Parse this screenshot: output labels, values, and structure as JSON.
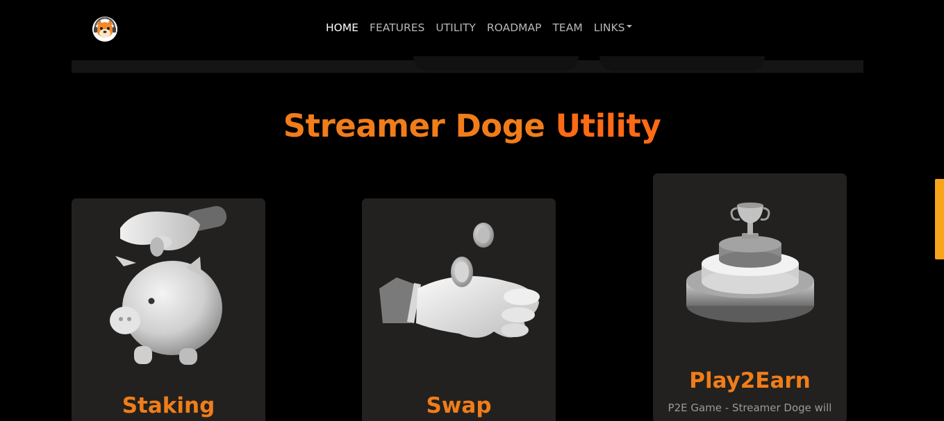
{
  "nav": {
    "logo_alt": "Streamer Doge logo",
    "links": [
      {
        "label": "HOME",
        "active": true
      },
      {
        "label": "FEATURES"
      },
      {
        "label": "UTILITY"
      },
      {
        "label": "ROADMAP"
      },
      {
        "label": "TEAM"
      },
      {
        "label": "LINKS"
      }
    ]
  },
  "section": {
    "title_part1": "Streamer Doge",
    "title_part2": "Utility"
  },
  "cards": [
    {
      "title": "Staking",
      "icon": "piggy-bank-coin-icon",
      "description": ""
    },
    {
      "title": "Swap",
      "icon": "hand-coins-icon",
      "description": ""
    },
    {
      "title": "Play2Earn",
      "icon": "trophy-podium-icon",
      "description": "P2E Game - Streamer Doge will"
    }
  ],
  "colors": {
    "background": "#000000",
    "card": "#22211f",
    "accent": "#f07d1a",
    "accent_red": "#ff6a14",
    "scroll": "#f7a41a"
  }
}
